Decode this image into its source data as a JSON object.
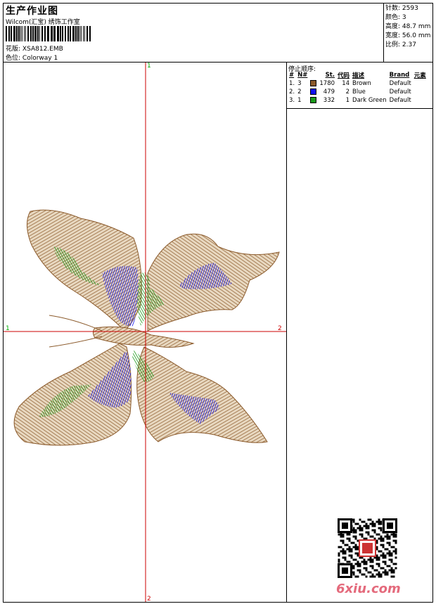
{
  "header": {
    "title": "生产作业图",
    "company": "Wilcom(汇宝) 绣饰工作室",
    "design_label": "花版:",
    "design_file": "XSA812.EMB",
    "colorway_label": "色位:",
    "colorway_name": "Colorway 1"
  },
  "stats": [
    {
      "label": "针数:",
      "value": "2593"
    },
    {
      "label": "颜色:",
      "value": "3"
    },
    {
      "label": "高度:",
      "value": "48.7 mm"
    },
    {
      "label": "宽度:",
      "value": "56.0 mm"
    },
    {
      "label": "比例:",
      "value": "2.37"
    }
  ],
  "stop_sequence": {
    "title": "停止顺序:",
    "headers": [
      "#",
      "N#",
      "St.",
      "代码",
      "描述",
      "Brand",
      "元素"
    ],
    "rows": [
      {
        "index": "1.",
        "n": "3",
        "color": "#8b5a2b",
        "stitches": "1780",
        "code": "14",
        "desc": "Brown",
        "brand": "Default"
      },
      {
        "index": "2.",
        "n": "2",
        "color": "#1010ee",
        "stitches": "479",
        "code": "2",
        "desc": "Blue",
        "brand": "Default"
      },
      {
        "index": "3.",
        "n": "1",
        "color": "#1a9a1a",
        "stitches": "332",
        "code": "1",
        "desc": "Dark Green",
        "brand": "Default"
      }
    ]
  },
  "axes": {
    "top": "1",
    "bottom": "2",
    "left": "1",
    "right": "2"
  },
  "watermark": "6xiu.com",
  "colors": {
    "brown": "#8b5a2b",
    "blue": "#1010ee",
    "green": "#1a9a1a",
    "axis": "#cc0000"
  }
}
